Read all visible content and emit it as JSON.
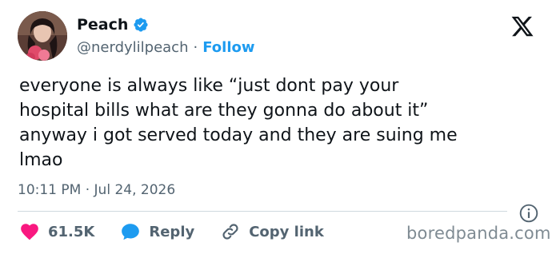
{
  "author": {
    "name": "Peach",
    "handle": "@nerdylilpeach",
    "separator": "·",
    "follow_label": "Follow"
  },
  "tweet": {
    "text": "everyone is always like “just dont pay your\nhospital bills what are they gonna do about it”\nanyway i got served today and they are suing me\nlmao",
    "timestamp": "10:11 PM · Jul 24, 2026"
  },
  "actions": {
    "likes": "61.5K",
    "reply_label": "Reply",
    "copy_link_label": "Copy link"
  },
  "watermark": "boredpanda.com",
  "colors": {
    "accent": "#1d9bf0",
    "like": "#f91880",
    "text": "#0f1419",
    "muted": "#536471"
  },
  "icons": [
    "verified-badge-icon",
    "x-logo-icon",
    "info-icon",
    "heart-icon",
    "reply-bubble-icon",
    "link-icon"
  ]
}
